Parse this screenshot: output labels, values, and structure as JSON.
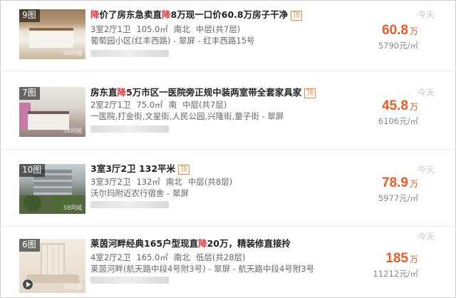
{
  "listings": [
    {
      "photo_count": "9图",
      "photo_watermark": "58同城",
      "title": {
        "parts": [
          {
            "text": "降",
            "hl": true
          },
          {
            "text": "价了房东急卖直",
            "hl": false
          },
          {
            "text": "降",
            "hl": true
          },
          {
            "text": "8万现一口价60.8万房子干净",
            "hl": false
          }
        ]
      },
      "badge": "顶",
      "layout": "3室2厅1卫",
      "area": "105.0㎡",
      "orientation": "南北",
      "floor": "中层(共7层)",
      "address": "葡萄园小区(红丰西路) - 翠屏 - 红丰西路15号",
      "price": "60.8",
      "price_unit": "万",
      "unit_price": "5790元/㎡",
      "time": "今天",
      "has_video": false
    },
    {
      "photo_count": "7图",
      "photo_watermark": "58同城",
      "title": {
        "parts": [
          {
            "text": "房东直",
            "hl": false
          },
          {
            "text": "降",
            "hl": true
          },
          {
            "text": "5万市区一医院旁正规中装两室带全套家具家",
            "hl": false
          }
        ]
      },
      "badge": "顶",
      "layout": "2室2厅1卫",
      "area": "75.0㎡",
      "orientation": "南",
      "floor": "中层(共7层)",
      "address": "一医院,打金街,文星街,人民公园,兴隆街,童子街 - 翠屏",
      "price": "45.8",
      "price_unit": "万",
      "unit_price": "6106元/㎡",
      "time": "今天",
      "has_video": false
    },
    {
      "photo_count": "10图",
      "photo_watermark": "58同城",
      "title": {
        "parts": [
          {
            "text": "3室3厅2卫 132平米",
            "hl": false
          }
        ]
      },
      "badge": "顶",
      "layout": "3室3厅2卫",
      "area": "132㎡",
      "orientation": "南北",
      "floor": "中层(共8层)",
      "address": "沃尔玛附近农行宿舍 - 翠屏",
      "price": "78.9",
      "price_unit": "万",
      "unit_price": "5977元/㎡",
      "time": "今天",
      "has_video": false
    },
    {
      "photo_count": "6图",
      "photo_watermark": "58同城",
      "title": {
        "parts": [
          {
            "text": "莱茵河畔经典165户型现直",
            "hl": false
          },
          {
            "text": "降",
            "hl": true
          },
          {
            "text": "20万，精装修直接拎",
            "hl": false
          }
        ]
      },
      "badge": "",
      "layout": "4室2厅2卫",
      "area": "165.0㎡",
      "orientation": "南北",
      "floor": "低层(共28层)",
      "address": "莱茵河畔(航天路中段4号附3号) - 翠屏 - 航天路中段4号附3号",
      "price": "185",
      "price_unit": "万",
      "unit_price": "11212元/㎡",
      "time": "今天",
      "has_video": true
    }
  ],
  "colors": {
    "price": "#f15a22",
    "highlight": "#e4393c",
    "badge": "#f08a3c",
    "time": "#c9c9c9"
  }
}
